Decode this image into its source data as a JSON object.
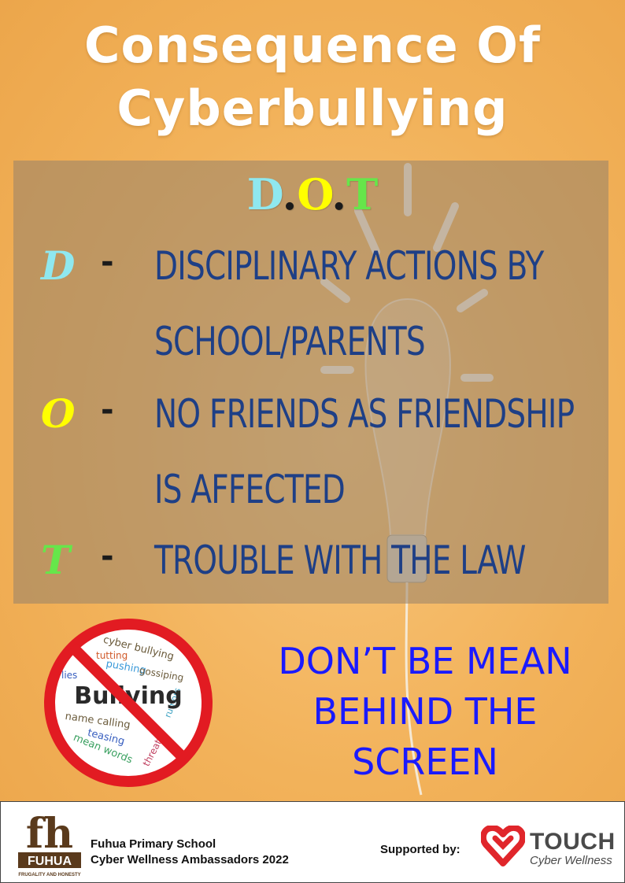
{
  "poster": {
    "title_line1": "Consequence Of",
    "title_line2": "Cyberbullying",
    "dot_heading": {
      "letters": [
        "D",
        ".",
        "O",
        ".",
        "T"
      ],
      "colors": [
        "#8fe8ef",
        "#1b1b1b",
        "#ffff00",
        "#1b1b1b",
        "#66e64a"
      ]
    },
    "items": [
      {
        "letter": "D",
        "dash": "-",
        "line1": "DISCIPLINARY ACTIONS BY",
        "line2": "SCHOOL/PARENTS",
        "color": "#8fe8ef"
      },
      {
        "letter": "O",
        "dash": "-",
        "line1": "NO FRIENDS AS FRIENDSHIP",
        "line2": "IS AFFECTED",
        "color": "#ffff00"
      },
      {
        "letter": "T",
        "dash": "-",
        "line1": "TROUBLE WITH THE LAW",
        "line2": "",
        "color": "#66e64a"
      }
    ],
    "slogan": [
      "DON’T  BE MEAN",
      "BEHIND THE",
      "SCREEN"
    ],
    "sign": {
      "center_word": "Bullying",
      "words": [
        "cyber bullying",
        "tutting",
        "pushing",
        "gossiping",
        "lies",
        "rumors",
        "name calling",
        "teasing",
        "mean words",
        "threats"
      ]
    }
  },
  "footer": {
    "logo_letters": "fh",
    "logo_name": "FUHUA",
    "logo_motto": "FRUGALITY AND HONESTY",
    "school_line1": "Fuhua Primary School",
    "school_line2": "Cyber Wellness Ambassadors 2022",
    "supported_label": "Supported by:",
    "touch_name": "TOUCH",
    "touch_sub": "Cyber Wellness"
  },
  "colors": {
    "title": "#ffffff",
    "item_text": "#1e3f86",
    "slogan": "#1a1aff",
    "no_sign_red": "#e21b22",
    "touch_red": "#e0262b"
  }
}
